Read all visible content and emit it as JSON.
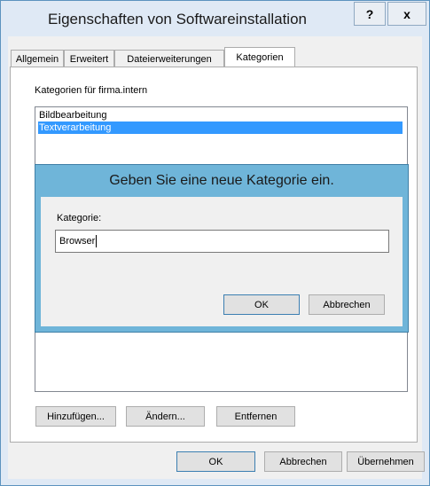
{
  "window": {
    "title": "Eigenschaften von Softwareinstallation",
    "help_button": "?",
    "close_button": "x"
  },
  "tabs": [
    {
      "label": "Allgemein",
      "active": false
    },
    {
      "label": "Erweitert",
      "active": false
    },
    {
      "label": "Dateierweiterungen",
      "active": false
    },
    {
      "label": "Kategorien",
      "active": true
    }
  ],
  "kategorien": {
    "list_label": "Kategorien für firma.intern",
    "items": [
      {
        "label": "Bildbearbeitung",
        "selected": false
      },
      {
        "label": "Textverarbeitung",
        "selected": true
      }
    ],
    "buttons": {
      "add": "Hinzufügen...",
      "change": "Ändern...",
      "remove": "Entfernen"
    }
  },
  "dialog": {
    "title": "Geben Sie eine neue Kategorie ein.",
    "field_label": "Kategorie:",
    "field_value": "Browser",
    "ok": "OK",
    "cancel": "Abbrechen"
  },
  "footer": {
    "ok": "OK",
    "cancel": "Abbrechen",
    "apply": "Übernehmen"
  },
  "colors": {
    "selection": "#3399ff",
    "dialog_frame": "#6fb5d9",
    "window_frame": "#dfe9f5"
  }
}
